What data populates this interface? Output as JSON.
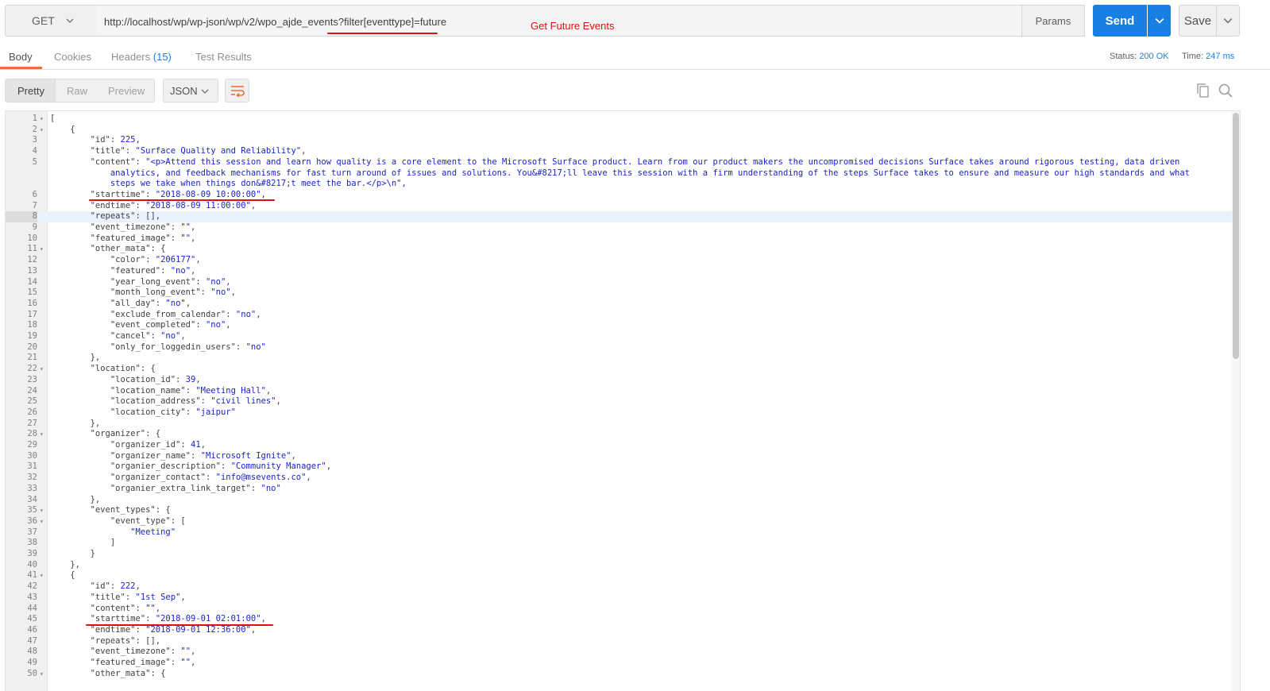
{
  "request": {
    "method": "GET",
    "url": "http://localhost/wp/wp-json/wp/v2/wpo_ajde_events?filter[eventtype]=future",
    "annotation": "Get Future Events",
    "params_label": "Params",
    "send_label": "Send",
    "save_label": "Save"
  },
  "response_tabs": {
    "body": "Body",
    "cookies": "Cookies",
    "headers": "Headers",
    "headers_count": "(15)",
    "test_results": "Test Results"
  },
  "status": {
    "status_label": "Status:",
    "status_value": "200 OK",
    "time_label": "Time:",
    "time_value": "247 ms"
  },
  "view": {
    "pretty": "Pretty",
    "raw": "Raw",
    "preview": "Preview",
    "language": "JSON"
  },
  "code_lines": [
    {
      "n": "1",
      "fold": true,
      "text": "["
    },
    {
      "n": "2",
      "fold": true,
      "text": "    {"
    },
    {
      "n": "3",
      "text": "        \"id\": 225,"
    },
    {
      "n": "4",
      "text": "        \"title\": \"Surface Quality and Reliability\","
    },
    {
      "n": "5",
      "text": "        \"content\": \"<p>Attend this session and learn how quality is a core element to the Microsoft Surface product. Learn from our product makers the uncompromised decisions Surface takes around rigorous testing, data driven"
    },
    {
      "n": "",
      "text": "            analytics, and feedback mechanisms for fast turn around of issues and solutions. You&#8217;ll leave this session with a firm understanding of the steps Surface takes to ensure and measure our high standards and what"
    },
    {
      "n": "",
      "text": "            steps we take when things don&#8217;t meet the bar.</p>\\n\","
    },
    {
      "n": "6",
      "text": "        \"starttime\": \"2018-08-09 10:00:00\","
    },
    {
      "n": "7",
      "text": "        \"endtime\": \"2018-08-09 11:00:00\","
    },
    {
      "n": "8",
      "text": "        \"repeats\": [],",
      "hl": true
    },
    {
      "n": "9",
      "text": "        \"event_timezone\": \"\","
    },
    {
      "n": "10",
      "text": "        \"featured_image\": \"\","
    },
    {
      "n": "11",
      "fold": true,
      "text": "        \"other_mata\": {"
    },
    {
      "n": "12",
      "text": "            \"color\": \"206177\","
    },
    {
      "n": "13",
      "text": "            \"featured\": \"no\","
    },
    {
      "n": "14",
      "text": "            \"year_long_event\": \"no\","
    },
    {
      "n": "15",
      "text": "            \"month_long_event\": \"no\","
    },
    {
      "n": "16",
      "text": "            \"all_day\": \"no\","
    },
    {
      "n": "17",
      "text": "            \"exclude_from_calendar\": \"no\","
    },
    {
      "n": "18",
      "text": "            \"event_completed\": \"no\","
    },
    {
      "n": "19",
      "text": "            \"cancel\": \"no\","
    },
    {
      "n": "20",
      "text": "            \"only_for_loggedin_users\": \"no\""
    },
    {
      "n": "21",
      "text": "        },"
    },
    {
      "n": "22",
      "fold": true,
      "text": "        \"location\": {"
    },
    {
      "n": "23",
      "text": "            \"location_id\": 39,"
    },
    {
      "n": "24",
      "text": "            \"location_name\": \"Meeting Hall\","
    },
    {
      "n": "25",
      "text": "            \"location_address\": \"civil lines\","
    },
    {
      "n": "26",
      "text": "            \"location_city\": \"jaipur\""
    },
    {
      "n": "27",
      "text": "        },"
    },
    {
      "n": "28",
      "fold": true,
      "text": "        \"organizer\": {"
    },
    {
      "n": "29",
      "text": "            \"organizer_id\": 41,"
    },
    {
      "n": "30",
      "text": "            \"organizer_name\": \"Microsoft Ignite\","
    },
    {
      "n": "31",
      "text": "            \"organier_description\": \"Community Manager\","
    },
    {
      "n": "32",
      "text": "            \"organizer_contact\": \"info@msevents.co\","
    },
    {
      "n": "33",
      "text": "            \"organier_extra_link_target\": \"no\""
    },
    {
      "n": "34",
      "text": "        },"
    },
    {
      "n": "35",
      "fold": true,
      "text": "        \"event_types\": {"
    },
    {
      "n": "36",
      "fold": true,
      "text": "            \"event_type\": ["
    },
    {
      "n": "37",
      "text": "                \"Meeting\""
    },
    {
      "n": "38",
      "text": "            ]"
    },
    {
      "n": "39",
      "text": "        }"
    },
    {
      "n": "40",
      "text": "    },"
    },
    {
      "n": "41",
      "fold": true,
      "text": "    {"
    },
    {
      "n": "42",
      "text": "        \"id\": 222,"
    },
    {
      "n": "43",
      "text": "        \"title\": \"1st Sep\","
    },
    {
      "n": "44",
      "text": "        \"content\": \"\","
    },
    {
      "n": "45",
      "text": "        \"starttime\": \"2018-09-01 02:01:00\","
    },
    {
      "n": "46",
      "text": "        \"endtime\": \"2018-09-01 12:36:00\","
    },
    {
      "n": "47",
      "text": "        \"repeats\": [],"
    },
    {
      "n": "48",
      "text": "        \"event_timezone\": \"\","
    },
    {
      "n": "49",
      "text": "        \"featured_image\": \"\","
    },
    {
      "n": "50",
      "fold": true,
      "text": "        \"other_mata\": {"
    }
  ],
  "colors": {
    "accent": "#1a7fe3",
    "tab_active": "#f26b3a",
    "annotation": "#e01010",
    "string": "#1a25c9"
  }
}
